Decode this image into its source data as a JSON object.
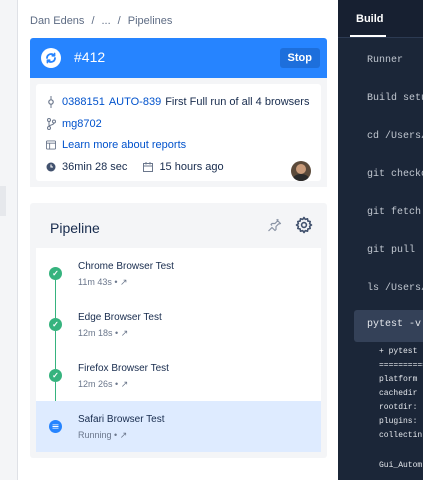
{
  "breadcrumb": {
    "items": [
      "Dan Edens",
      "...",
      "Pipelines"
    ],
    "separator": "/"
  },
  "build": {
    "number": "#412",
    "stop_label": "Stop",
    "commit_hash": "0388151",
    "commit_issue": "AUTO-839",
    "commit_message": "First Full run of all 4 browsers",
    "branch": "mg8702",
    "reports_link": "Learn more about reports",
    "duration": "36min 28 sec",
    "started": "15 hours ago",
    "accent_color": "#2684ff"
  },
  "pipeline": {
    "title": "Pipeline",
    "steps": [
      {
        "name": "Chrome Browser Test",
        "meta": "11m 43s",
        "status": "success"
      },
      {
        "name": "Edge Browser Test",
        "meta": "12m 18s",
        "status": "success"
      },
      {
        "name": "Firefox Browser Test",
        "meta": "12m 26s",
        "status": "success"
      },
      {
        "name": "Safari Browser Test",
        "meta": "Running",
        "status": "running"
      }
    ],
    "meta_separator": "•",
    "link_glyph": "↗",
    "success_color": "#36b37e",
    "running_color": "#2684ff"
  },
  "terminal": {
    "tab": "Build",
    "lines": [
      "Runner",
      "Build setu",
      "cd /Users/",
      "git checko",
      "git fetch",
      "git pull",
      "ls /Users/"
    ],
    "active_command": "pytest -v",
    "output": [
      "+ pytest",
      "==========",
      "platform",
      "cachedir",
      "rootdir:",
      "plugins:",
      "collectin",
      "",
      "Gui_Autom"
    ]
  }
}
